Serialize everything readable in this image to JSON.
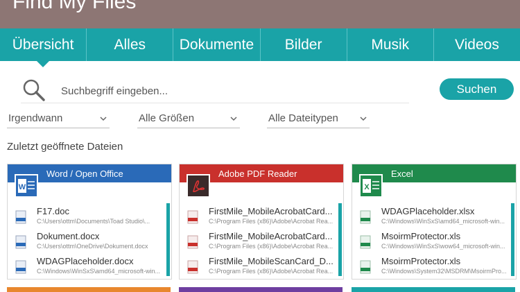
{
  "app": {
    "title": "Find My Files"
  },
  "tabs": [
    {
      "label": "Übersicht",
      "active": true
    },
    {
      "label": "Alles"
    },
    {
      "label": "Dokumente"
    },
    {
      "label": "Bilder"
    },
    {
      "label": "Musik"
    },
    {
      "label": "Videos"
    }
  ],
  "search": {
    "placeholder": "Suchbegriff eingeben...",
    "button_label": "Suchen"
  },
  "filters": [
    {
      "label": "Irgendwann"
    },
    {
      "label": "Alle Größen"
    },
    {
      "label": "Alle Dateitypen"
    }
  ],
  "section_title": "Zuletzt geöffnete Dateien",
  "colors": {
    "accent": "#1aa3a7",
    "titlebar": "#8d7674",
    "word": "#2a6ab8",
    "pdf": "#c9302c",
    "excel": "#1f8a4c",
    "orange": "#e8872e",
    "purple": "#6e3ea0"
  },
  "cards": [
    {
      "title": "Word / Open Office",
      "icon": "word-icon",
      "files": [
        {
          "name": "F17.doc",
          "path": "C:\\Users\\ottm\\Documents\\Toad Studio\\..."
        },
        {
          "name": "Dokument.docx",
          "path": "C:\\Users\\ottm\\OneDrive\\Dokument.docx"
        },
        {
          "name": "WDAGPlaceholder.docx",
          "path": "C:\\Windows\\WinSxS\\amd64_microsoft-win..."
        }
      ]
    },
    {
      "title": "Adobe PDF Reader",
      "icon": "pdf-icon",
      "files": [
        {
          "name": "FirstMile_MobileAcrobatCard...",
          "path": "C:\\Program Files (x86)\\Adobe\\Acrobat Rea..."
        },
        {
          "name": "FirstMile_MobileAcrobatCard...",
          "path": "C:\\Program Files (x86)\\Adobe\\Acrobat Rea..."
        },
        {
          "name": "FirstMile_MobileScanCard_D...",
          "path": "C:\\Program Files (x86)\\Adobe\\Acrobat Rea..."
        }
      ]
    },
    {
      "title": "Excel",
      "icon": "excel-icon",
      "files": [
        {
          "name": "WDAGPlaceholder.xlsx",
          "path": "C:\\Windows\\WinSxS\\amd64_microsoft-win..."
        },
        {
          "name": "MsoirmProtector.xls",
          "path": "C:\\Windows\\WinSxS\\wow64_microsoft-win..."
        },
        {
          "name": "MsoirmProtector.xls",
          "path": "C:\\Windows\\System32\\MSDRM\\MsoirmPro..."
        }
      ]
    }
  ]
}
